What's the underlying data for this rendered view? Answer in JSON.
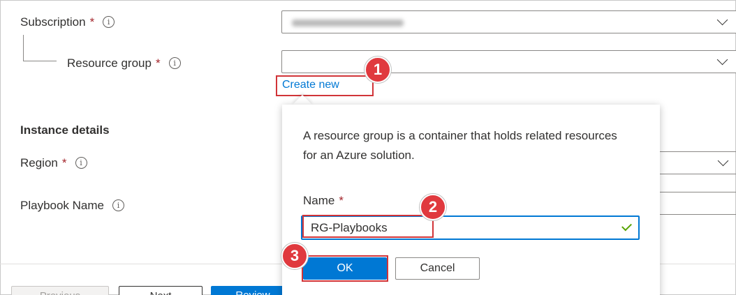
{
  "form": {
    "subscription": {
      "label": "Subscription",
      "required": "*",
      "info": "i"
    },
    "resource_group": {
      "label": "Resource group",
      "required": "*",
      "info": "i",
      "value": ""
    },
    "create_new": "Create new",
    "instance_details": "Instance details",
    "region": {
      "label": "Region",
      "required": "*",
      "info": "i"
    },
    "playbook_name": {
      "label": "Playbook Name",
      "info": "i"
    }
  },
  "popover": {
    "description": "A resource group is a container that holds related resources for an Azure solution.",
    "name_label": "Name",
    "name_required": "*",
    "name_value": "RG-Playbooks",
    "ok": "OK",
    "cancel": "Cancel"
  },
  "footer": {
    "buttons": [
      "Previous",
      "Next",
      "Review"
    ]
  },
  "annotations": {
    "step1": "1",
    "step2": "2",
    "step3": "3"
  },
  "colors": {
    "accent": "#0078d4",
    "highlight": "#d13438",
    "badge": "#e0393e",
    "required": "#a4262c",
    "valid": "#57a300"
  }
}
